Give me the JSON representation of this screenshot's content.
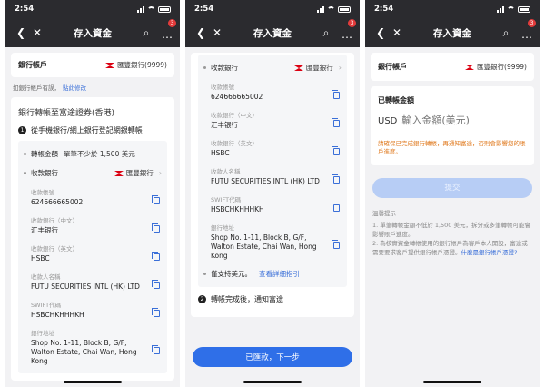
{
  "status": {
    "time": "2:54"
  },
  "nav": {
    "title": "存入資金",
    "badge": "3"
  },
  "screen1": {
    "account_label": "銀行帳戶",
    "account_bank": "匯豐銀行(9999)",
    "hint_text": "如銀行帳戶有誤，",
    "hint_link": "點此修改",
    "section_title": "銀行轉帳至富途證券(香港)",
    "step1_num": "1",
    "step1_text": "從手機銀行/網上銀行登記網銀轉帳",
    "amount_label": "轉帳金額",
    "amount_value": "單筆不少於 1,500 美元",
    "receive_bank_label": "收款銀行",
    "receive_bank_value": "匯豐銀行",
    "fields": [
      {
        "label": "收款帳號",
        "value": "624666665002"
      },
      {
        "label": "收款銀行（中文）",
        "value": "汇丰银行"
      },
      {
        "label": "收款銀行（英文）",
        "value": "HSBC"
      },
      {
        "label": "收款人名稱",
        "value": "FUTU SECURITIES INTL (HK) LTD"
      },
      {
        "label": "SWIFT代碼",
        "value": "HSBCHKHHHKH"
      },
      {
        "label": "銀行地址",
        "value": "Shop No. 1-11, Block B, G/F, Walton Estate, Chai Wan, Hong Kong"
      }
    ]
  },
  "screen2": {
    "receive_bank_label": "收款銀行",
    "receive_bank_value": "匯豐銀行",
    "fields": [
      {
        "label": "收款帳號",
        "value": "624666665002"
      },
      {
        "label": "收款銀行（中文）",
        "value": "汇丰银行"
      },
      {
        "label": "收款銀行（英文）",
        "value": "HSBC"
      },
      {
        "label": "收款人名稱",
        "value": "FUTU SECURITIES INTL (HK) LTD"
      },
      {
        "label": "SWIFT代碼",
        "value": "HSBCHKHHHKH"
      },
      {
        "label": "銀行地址",
        "value": "Shop No. 1-11, Block B, G/F, Walton Estate, Chai Wan, Hong Kong"
      }
    ],
    "support_text": "僅支持美元。",
    "support_link": "查看詳細指引",
    "step2_num": "2",
    "step2_text": "轉帳完成後，通知富途",
    "primary_button": "已匯款，下一步"
  },
  "screen3": {
    "account_label": "銀行帳戶",
    "account_bank": "匯豐銀行(9999)",
    "transferred_label": "已轉帳金額",
    "currency": "USD",
    "amount_placeholder": "輸入金額(美元)",
    "warning": "請確保已完成銀行轉帳，再通知富途，否則會影響您的賬戶進度。",
    "submit_button": "提交",
    "tips_title": "溫馨提示",
    "tip1": "1. 單筆轉帳金額不低於 1,500 美元，拆分或多筆轉帳可能會影響賬戶進度。",
    "tip2": "2. 為核實資金轉帳使用的銀行帳戶為客戶本人開設，富途或需要要求客戶提供銀行帳戶憑證。",
    "tip2_link": "什麼是銀行帳戶憑證?"
  }
}
